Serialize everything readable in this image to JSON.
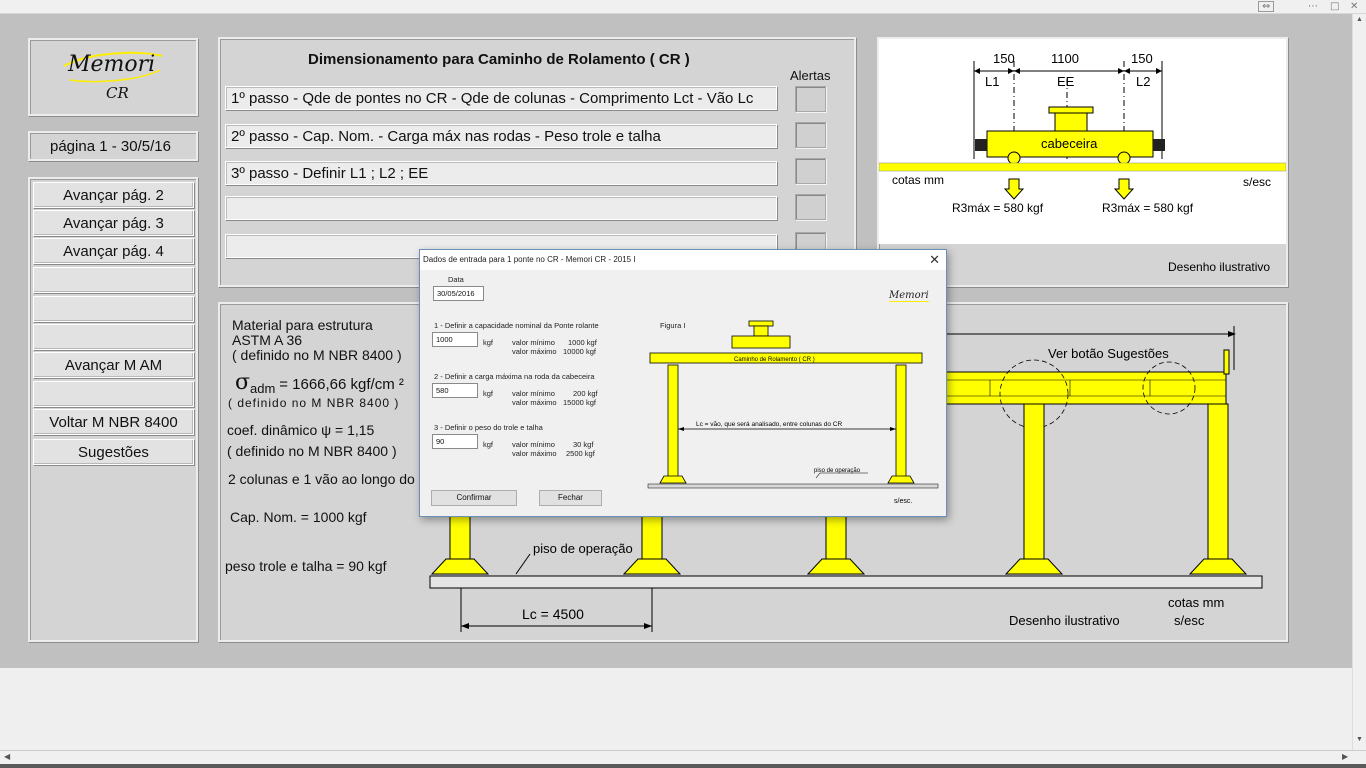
{
  "logo": {
    "name": "Memori",
    "sub": "CR"
  },
  "page_indicator": "página 1 -   30/5/16",
  "nav_buttons": [
    "Avançar pág. 2",
    "Avançar pág. 3",
    "Avançar pág. 4",
    "",
    "",
    "",
    "Avançar M AM",
    "",
    "Voltar M  NBR  8400",
    "Sugestões"
  ],
  "steps_panel": {
    "title": "Dimensionamento para Caminho de Rolamento ( CR )",
    "alerts_label": "Alertas",
    "steps": [
      "1º passo - Qde de pontes no CR - Qde de colunas - Comprimento Lct - Vão Lc",
      "2º passo - Cap. Nom. - Carga máx nas rodas - Peso trole e talha",
      "3º passo - Definir L1 ; L2 ; EE",
      "",
      ""
    ]
  },
  "top_drawing": {
    "dim_l1": "150",
    "dim_ee": "1100",
    "dim_l2": "150",
    "label_l1": "L1",
    "label_ee": "EE",
    "label_l2": "L2",
    "cabeceira": "cabeceira",
    "cotas": "cotas mm",
    "sesc": "s/esc",
    "load_left": "R3máx = 580 kgf",
    "load_right": "R3máx = 580 kgf",
    "caption": "Desenho ilustrativo"
  },
  "main_panel": {
    "material_l1": "Material para estrutura",
    "material_l2": "ASTM A 36",
    "material_l3": "( definido no M NBR 8400 )",
    "sigma_symbol": "σ",
    "sigma_sub": "adm",
    "sigma_value": "= 1666,66 kgf/cm ²",
    "sigma_def": "( definido no M NBR 8400 )",
    "coef": "coef. dinâmico ψ = 1,15",
    "coef_def": "( definido no M NBR 8400 )",
    "colunas": "2 colunas e 1 vão ao longo do CR",
    "cap_nom": "Cap. Nom. = 1000 kgf",
    "peso": "peso trole e talha = 90 kgf",
    "ver_botao": "Ver botão Sugestões",
    "piso": "piso de operação",
    "lc": "Lc = 4500",
    "cotas": "cotas mm",
    "caption": "Desenho ilustrativo",
    "sesc": "s/esc"
  },
  "dialog": {
    "title": "Dados de entrada para 1 ponte no CR - Memori CR - 2015 I",
    "data_label": "Data",
    "data_value": "30/05/2016",
    "logo": "Memori",
    "figura": "Figura I",
    "q1": "1 - Definir a capacidade nominal da Ponte rolante",
    "q1_value": "1000",
    "q1_unit": "kgf",
    "q1_min_label": "valor mínimo",
    "q1_min": "1000 kgf",
    "q1_max_label": "valor máximo",
    "q1_max": "10000 kgf",
    "q2": "2 - Definir a carga máxima na roda da cabeceira",
    "q2_value": "580",
    "q2_unit": "kgf",
    "q2_min_label": "valor mínimo",
    "q2_min": "200 kgf",
    "q2_max_label": "valor máximo",
    "q2_max": "15000 kgf",
    "q3": "3 - Definir o peso do trole e talha",
    "q3_value": "90",
    "q3_unit": "kgf",
    "q3_min_label": "valor mínimo",
    "q3_min": "30 kgf",
    "q3_max_label": "valor máximo",
    "q3_max": "2500 kgf",
    "confirm": "Confirmar",
    "close": "Fechar",
    "fig_beam": "Caminho de Rolamento ( CR )",
    "fig_lc": "Lc = vão, que será analisado, entre colunas do CR",
    "fig_piso": "piso de operação",
    "fig_sesc": "s/esc."
  },
  "colors": {
    "yellow": "#ffff00",
    "panel": "#d4d4d4",
    "background": "#c0c0c0"
  }
}
